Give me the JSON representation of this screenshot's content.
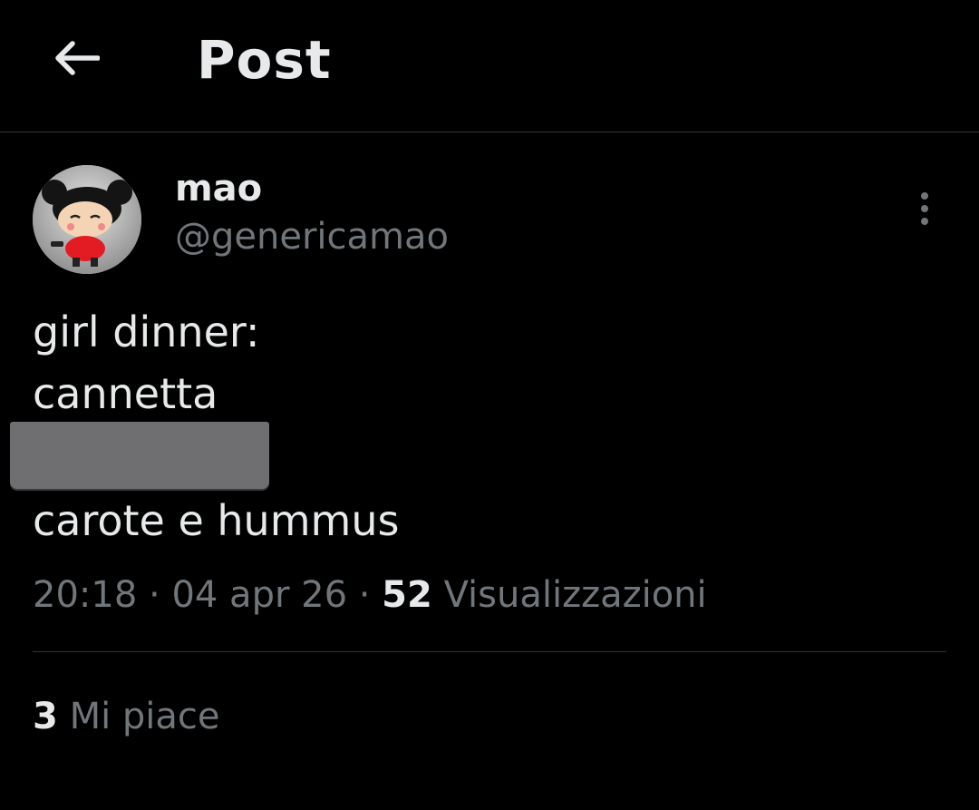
{
  "header": {
    "title": "Post",
    "back_icon": "arrow-left-icon"
  },
  "author": {
    "display_name": "mao",
    "handle": "@genericamao",
    "avatar_icon": "pucca-avatar"
  },
  "more_icon": "more-vertical-icon",
  "tweet": {
    "lines": [
      "girl dinner:",
      "cannetta",
      "carote e hummus"
    ],
    "redacted_line": true
  },
  "meta": {
    "time": "20:18",
    "separator": "·",
    "date": "04 apr 26",
    "views_count": "52",
    "views_label": "Visualizzazioni"
  },
  "likes": {
    "count": "3",
    "label": "Mi piace"
  },
  "colors": {
    "background": "#000000",
    "text_primary": "#e7e9ea",
    "text_secondary": "#71767b",
    "divider": "#2f3336",
    "redaction": "#6f6f72"
  }
}
